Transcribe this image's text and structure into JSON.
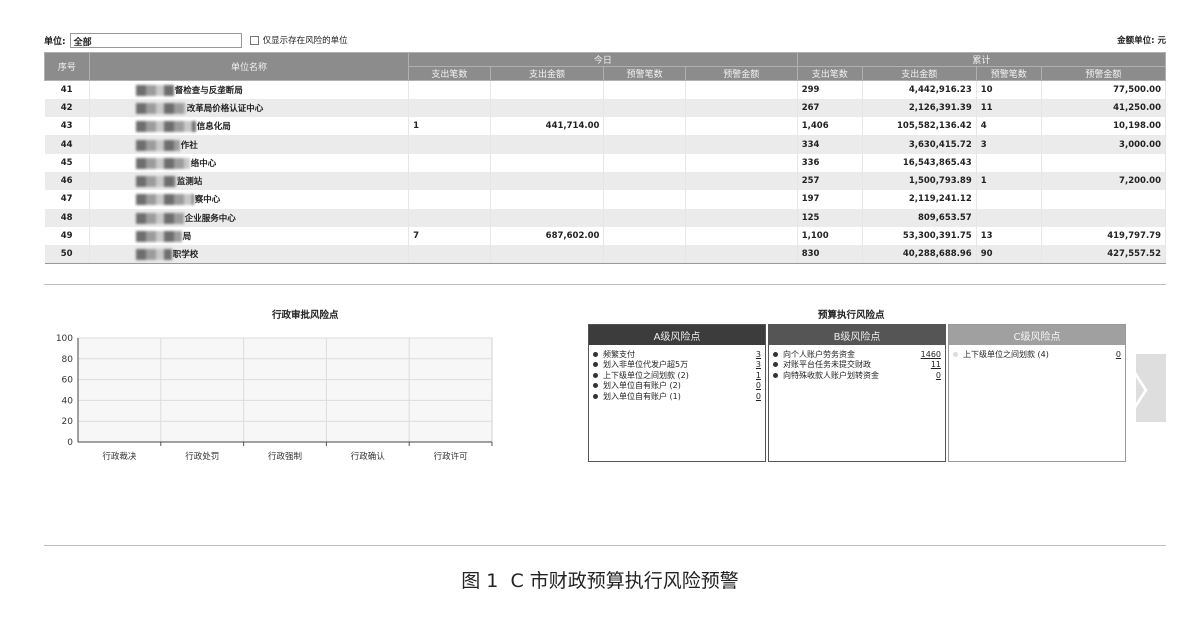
{
  "filter": {
    "unit_label": "单位:",
    "unit_value": "全部",
    "risk_only_label": "仅显示存在风险的单位",
    "amount_unit": "金额单位: 元"
  },
  "table": {
    "headers": {
      "seq": "序号",
      "name": "单位名称",
      "today": "今日",
      "cumulative": "累计",
      "sub": [
        "支出笔数",
        "支出金额",
        "预警笔数",
        "预警金额",
        "支出笔数",
        "支出金额",
        "预警笔数",
        "预警金额"
      ]
    },
    "rows": [
      {
        "seq": "41",
        "name": "督检查与反垄断局",
        "t_cnt": "",
        "t_amt": "",
        "t_wcnt": "",
        "t_wamt": "",
        "c_cnt": "299",
        "c_amt": "4,442,916.23",
        "c_wcnt": "10",
        "c_wamt": "77,500.00"
      },
      {
        "seq": "42",
        "name": "改革局价格认证中心",
        "t_cnt": "",
        "t_amt": "",
        "t_wcnt": "",
        "t_wamt": "",
        "c_cnt": "267",
        "c_amt": "2,126,391.39",
        "c_wcnt": "11",
        "c_wamt": "41,250.00"
      },
      {
        "seq": "43",
        "name": "信息化局",
        "t_cnt": "1",
        "t_amt": "441,714.00",
        "t_wcnt": "",
        "t_wamt": "",
        "c_cnt": "1,406",
        "c_amt": "105,582,136.42",
        "c_wcnt": "4",
        "c_wamt": "10,198.00"
      },
      {
        "seq": "44",
        "name": "作社",
        "t_cnt": "",
        "t_amt": "",
        "t_wcnt": "",
        "t_wamt": "",
        "c_cnt": "334",
        "c_amt": "3,630,415.72",
        "c_wcnt": "3",
        "c_wamt": "3,000.00"
      },
      {
        "seq": "45",
        "name": "络中心",
        "t_cnt": "",
        "t_amt": "",
        "t_wcnt": "",
        "t_wamt": "",
        "c_cnt": "336",
        "c_amt": "16,543,865.43",
        "c_wcnt": "",
        "c_wamt": ""
      },
      {
        "seq": "46",
        "name": "监测站",
        "t_cnt": "",
        "t_amt": "",
        "t_wcnt": "",
        "t_wamt": "",
        "c_cnt": "257",
        "c_amt": "1,500,793.89",
        "c_wcnt": "1",
        "c_wamt": "7,200.00"
      },
      {
        "seq": "47",
        "name": "察中心",
        "t_cnt": "",
        "t_amt": "",
        "t_wcnt": "",
        "t_wamt": "",
        "c_cnt": "197",
        "c_amt": "2,119,241.12",
        "c_wcnt": "",
        "c_wamt": ""
      },
      {
        "seq": "48",
        "name": "企业服务中心",
        "t_cnt": "",
        "t_amt": "",
        "t_wcnt": "",
        "t_wamt": "",
        "c_cnt": "125",
        "c_amt": "809,653.57",
        "c_wcnt": "",
        "c_wamt": ""
      },
      {
        "seq": "49",
        "name": "局",
        "t_cnt": "7",
        "t_amt": "687,602.00",
        "t_wcnt": "",
        "t_wamt": "",
        "c_cnt": "1,100",
        "c_amt": "53,300,391.75",
        "c_wcnt": "13",
        "c_wamt": "419,797.79"
      },
      {
        "seq": "50",
        "name": "职学校",
        "t_cnt": "",
        "t_amt": "",
        "t_wcnt": "",
        "t_wamt": "",
        "c_cnt": "830",
        "c_amt": "40,288,688.96",
        "c_wcnt": "90",
        "c_wamt": "427,557.52"
      }
    ]
  },
  "admin_risk": {
    "title": "行政审批风险点"
  },
  "chart_data": {
    "type": "bar",
    "title": "行政审批风险点",
    "categories": [
      "行政裁决",
      "行政处罚",
      "行政强制",
      "行政确认",
      "行政许可"
    ],
    "values": [
      0,
      0,
      0,
      0,
      0
    ],
    "ylim": [
      0,
      100
    ],
    "yticks": [
      0,
      20,
      40,
      60,
      80,
      100
    ],
    "grid": true
  },
  "budget_risk": {
    "title": "预算执行风险点",
    "panels": [
      {
        "label": "A级风险点",
        "items": [
          {
            "label": "频繁支付",
            "value": "3"
          },
          {
            "label": "划入非单位代发户超5万",
            "value": "3"
          },
          {
            "label": "上下级单位之间划款 (2)",
            "value": "1"
          },
          {
            "label": "划入单位自有账户 (2)",
            "value": "0"
          },
          {
            "label": "划入单位自有账户 (1)",
            "value": "0"
          }
        ]
      },
      {
        "label": "B级风险点",
        "items": [
          {
            "label": "向个人账户劳务资金",
            "value": "1460"
          },
          {
            "label": "对账平台任务未提交财政",
            "value": "11"
          },
          {
            "label": "向特殊收款人账户划转资金",
            "value": "0"
          }
        ]
      },
      {
        "label": "C级风险点",
        "items": [
          {
            "label": "上下级单位之间划款 (4)",
            "value": "0"
          }
        ]
      }
    ],
    "next_glyph": "〉"
  },
  "caption": {
    "fig": "图 1",
    "text": "C 市财政预算执行风险预警"
  }
}
